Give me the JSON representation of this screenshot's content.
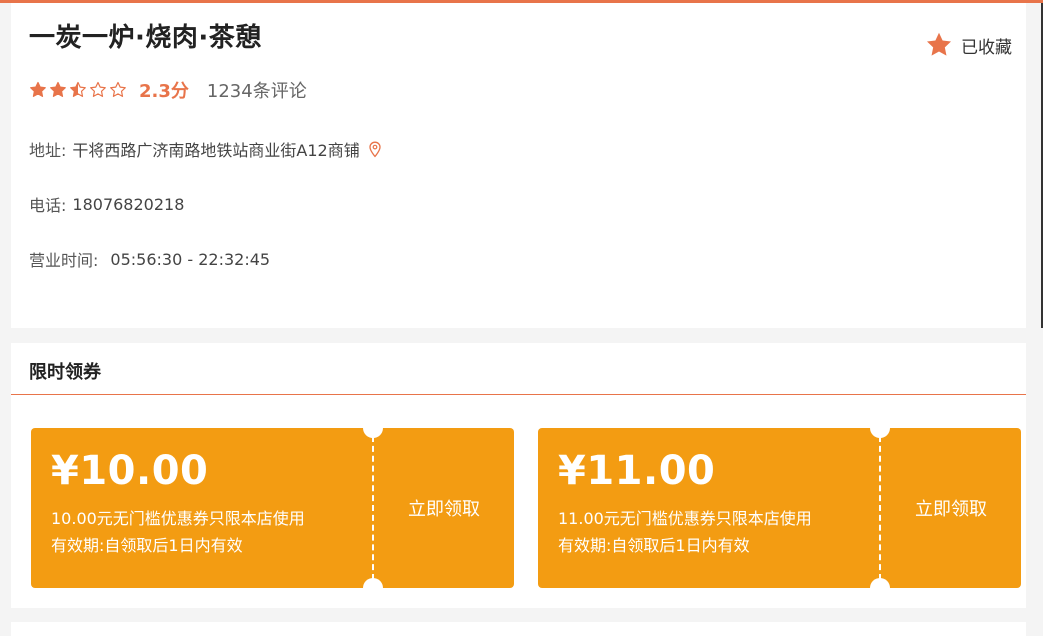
{
  "shop": {
    "name": "一炭一炉·烧肉·茶憩",
    "favorite_label": "已收藏",
    "rating": {
      "value": 2.5,
      "score_text": "2.3分",
      "reviews_text": "1234条评论"
    },
    "address": {
      "label": "地址:",
      "value": "干将西路广济南路地铁站商业街A12商铺"
    },
    "phone": {
      "label": "电话:",
      "value": "18076820218"
    },
    "hours": {
      "label": "营业时间:",
      "value": "05:56:30 - 22:32:45"
    }
  },
  "coupons_section": {
    "title": "限时领券",
    "coupons": [
      {
        "amount": "¥10.00",
        "desc": "10.00元无门槛优惠券只限本店使用",
        "validity": "有效期:自领取后1日内有效",
        "button": "立即领取"
      },
      {
        "amount": "¥11.00",
        "desc": "11.00元无门槛优惠券只限本店使用",
        "validity": "有效期:自领取后1日内有效",
        "button": "立即领取"
      }
    ]
  },
  "colors": {
    "accent": "#e8744a",
    "coupon_bg": "#f39c12",
    "page_bg": "#f4f4f4"
  },
  "icons": {
    "favorite": "star-icon",
    "location": "location-pin-icon",
    "rating": "star-icon"
  }
}
